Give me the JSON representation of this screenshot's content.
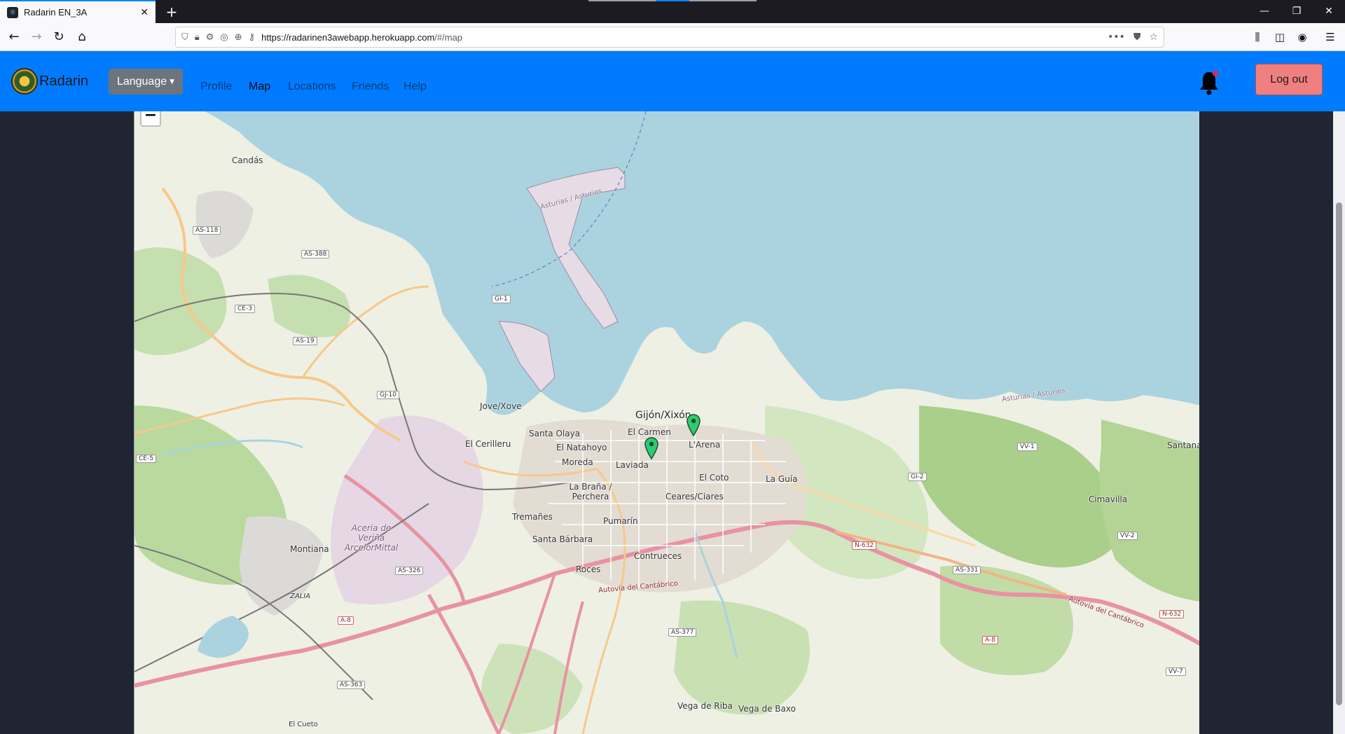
{
  "browser": {
    "tab_title": "Radarin EN_3A",
    "url_host": "https://radarinen3awebapp.herokuapp.com",
    "url_path": "/#/map"
  },
  "app": {
    "brand": "Radarin",
    "language_label": "Language",
    "nav": [
      "Profile",
      "Map",
      "Locations",
      "Friends",
      "Help"
    ],
    "active_nav": "Map",
    "logout_label": "Log out",
    "accent_color": "#007bff",
    "logout_color": "#f08080"
  },
  "map": {
    "zoom_out_label": "−",
    "places": [
      "Candás",
      "Jove/Xove",
      "Gijón/Xixón",
      "El Carmen",
      "L'Arena",
      "Santa Olaya",
      "El Cerilleru",
      "El Natahoyo",
      "Moreda",
      "Laviada",
      "El Coto",
      "La Guía",
      "La Braña / Perchera",
      "Ceares/Ciares",
      "Tremañes",
      "Pumarín",
      "Santa Bárbara",
      "Contrueces",
      "Roces",
      "Montiana",
      "Aceria de Veriña ArcelorMittal",
      "Santana",
      "Cimavilla",
      "Vega de Riba",
      "Vega de Baxo",
      "El Cueto",
      "ZALIA"
    ],
    "roads": [
      "AS-118",
      "AS-388",
      "CE-3",
      "AS-19",
      "GJ-10",
      "GI-1",
      "CE-5",
      "AS-326",
      "A-8",
      "AS-363",
      "AS-377",
      "N-632",
      "AS-331",
      "VV-1",
      "GI-2",
      "VV-2",
      "VV-7"
    ],
    "water_labels": [
      "Asturias / Asturies"
    ],
    "road_names": [
      "Autovía del Cantábrico"
    ]
  }
}
